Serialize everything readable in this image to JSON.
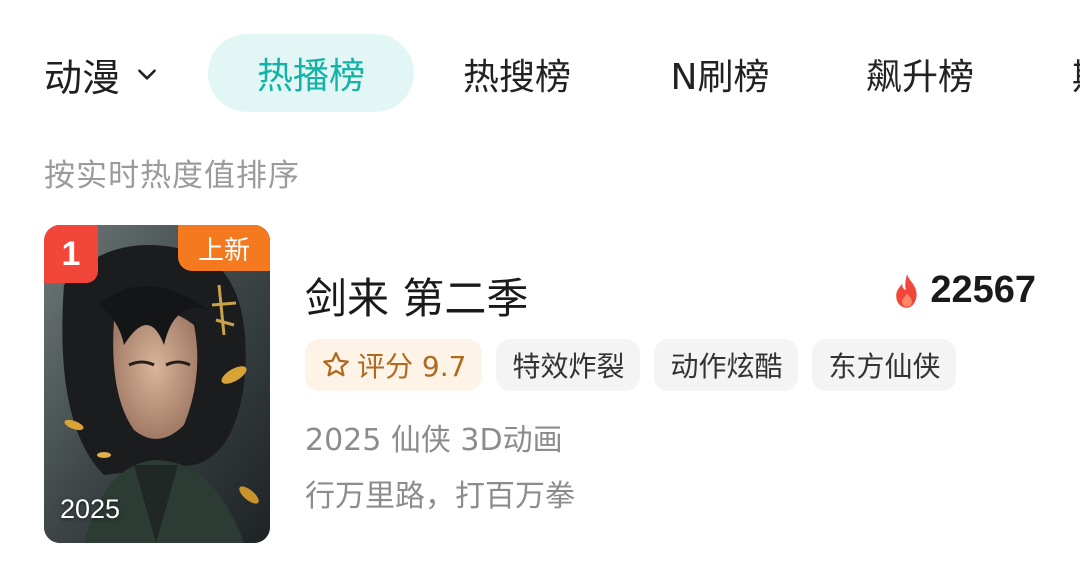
{
  "category": {
    "label": "动漫",
    "icon": "chevron-down-icon"
  },
  "tabs": [
    {
      "label": "热播榜",
      "active": true
    },
    {
      "label": "热搜榜",
      "active": false
    },
    {
      "label": "N刷榜",
      "active": false
    },
    {
      "label": "飙升榜",
      "active": false
    },
    {
      "label": "期",
      "active": false
    }
  ],
  "subtitle": "按实时热度值排序",
  "item": {
    "rank": "1",
    "new_badge": "上新",
    "poster_year": "2025",
    "title": "剑来 第二季",
    "heat_value": "22567",
    "heat_icon": "flame-icon",
    "rating_label": "评分 9.7",
    "rating_icon": "star-outline-icon",
    "tags": [
      "特效炸裂",
      "动作炫酷",
      "东方仙侠"
    ],
    "meta": "2025 仙侠 3D动画",
    "description": "行万里路，打百万拳"
  },
  "colors": {
    "accent": "#14b3a8",
    "accent_bg": "#e2f7f5",
    "rank_badge": "#f2463b",
    "new_badge": "#f57a1f",
    "flame": "#f2463b",
    "rating_text": "#b06a20",
    "rating_bg": "#fdf3e6"
  }
}
